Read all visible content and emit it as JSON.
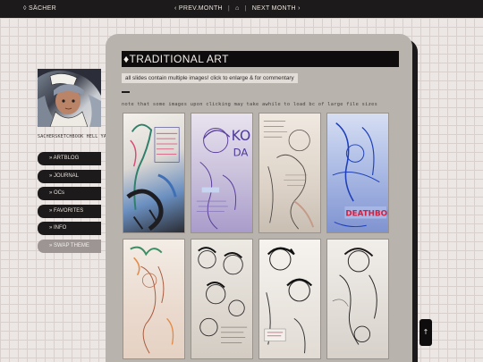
{
  "header": {
    "site_title": "◊ SÄCHER",
    "prev_label": "‹ PREV.MONTH",
    "divider": "|",
    "home_label": "⌂",
    "next_label": "NEXT MONTH ›"
  },
  "sidebar": {
    "username": "SACHERSKETCHBOOK HELL YA",
    "items": [
      {
        "label": "» ARTBLOG"
      },
      {
        "label": "» JOURNAL"
      },
      {
        "label": "» OCs"
      },
      {
        "label": "» FAVORITES"
      },
      {
        "label": "» INFO"
      },
      {
        "label": "» SWAP THEME"
      }
    ]
  },
  "main": {
    "title": "♦TRADITIONAL ART",
    "notice": "all slides contain multiple images! click to enlarge & for commentary",
    "note": "note that some images upon clicking may take awhile to load bc of large file sizes",
    "thumbnails": [
      {
        "icon": "sketch-thumbnail"
      },
      {
        "icon": "sketch-thumbnail"
      },
      {
        "icon": "sketch-thumbnail"
      },
      {
        "icon": "sketch-thumbnail",
        "caption": "DEATHBODY"
      },
      {
        "icon": "sketch-thumbnail"
      },
      {
        "icon": "sketch-thumbnail"
      },
      {
        "icon": "sketch-thumbnail"
      },
      {
        "icon": "sketch-thumbnail"
      }
    ]
  },
  "scroll_top": {
    "label": "↑"
  },
  "colors": {
    "background": "#ece7e4",
    "dark": "#1c1a1b",
    "panel": "#b9b3ad"
  }
}
